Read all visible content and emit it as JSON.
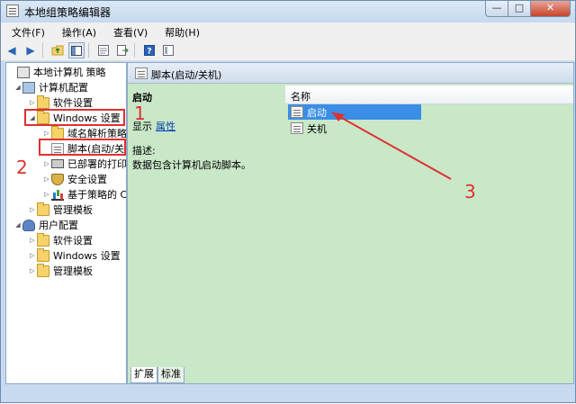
{
  "window": {
    "title": "本地组策略编辑器"
  },
  "window_buttons": {
    "minimize": "—",
    "maximize": "□",
    "close": "✕"
  },
  "menubar": {
    "items": [
      {
        "label": "文件(F)"
      },
      {
        "label": "操作(A)"
      },
      {
        "label": "查看(V)"
      },
      {
        "label": "帮助(H)"
      }
    ]
  },
  "toolbar": {
    "icons": [
      "back-arrow-icon",
      "forward-arrow-icon",
      "up-folder-icon",
      "show-hide-tree-icon",
      "properties-icon",
      "export-list-icon",
      "help-icon",
      "extended-view-icon"
    ]
  },
  "tree": {
    "root": "本地计算机 策略",
    "computer_config": "计算机配置",
    "software_settings_1": "软件设置",
    "windows_settings_1": "Windows 设置",
    "name_resolution": "域名解析策略",
    "scripts": "脚本(启动/关",
    "deployed_printers": "已部署的打印",
    "security_settings": "安全设置",
    "policy_qos": "基于策略的 C",
    "admin_templates_1": "管理模板",
    "user_config": "用户配置",
    "software_settings_2": "软件设置",
    "windows_settings_2": "Windows 设置",
    "admin_templates_2": "管理模板"
  },
  "main": {
    "header_title": "脚本(启动/关机)",
    "section_title": "启动",
    "show_label": "显示",
    "show_link": "属性",
    "description_label": "描述:",
    "description_text": "数据包含计算机启动脚本。",
    "list_header": "名称",
    "list_items": [
      "启动",
      "关机"
    ],
    "tabs": [
      "扩展",
      "标准"
    ]
  },
  "annotations": {
    "label_1": "1",
    "label_2": "2",
    "label_3": "3"
  },
  "colors": {
    "main_background": "#c9e8c8",
    "selection": "#3a8ee6",
    "annotation": "#e03030",
    "link": "#0645ad"
  }
}
